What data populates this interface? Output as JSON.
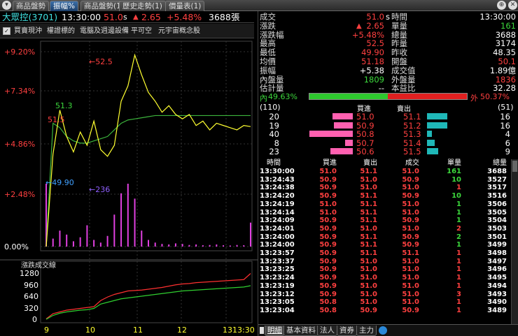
{
  "tabs": [
    {
      "label": "商品盤勢",
      "active": false
    },
    {
      "label": "振幅%",
      "active": true
    },
    {
      "label": "商品盤勢(1)",
      "active": false
    },
    {
      "label": "歷史走勢(1)",
      "active": false
    },
    {
      "label": "價量表(1)",
      "active": false
    }
  ],
  "header": {
    "symbol": "大眾控(3701)",
    "time": "13:30:00",
    "price": "51.0",
    "price_flag": "s",
    "change_arrow": "▲",
    "change": "2.65",
    "pct": "+5.48%",
    "volume": "3688",
    "volume_unit": "張"
  },
  "toolbar": {
    "items": [
      "買賣現沖",
      "權證標的",
      "電腦及週邊設備",
      "平可空",
      "元宇宙概念股"
    ]
  },
  "chart": {
    "y_labels": [
      "+9.20%",
      "+7.34%",
      "+4.86%",
      "+2.48%",
      "0.00%"
    ],
    "price_annotations": {
      "high": "←52.5",
      "open": "51.3",
      "low_mark": "51.5",
      "low": "←49.90",
      "max_vol": "←236"
    },
    "sub_title": "漲跌成交線",
    "sub_y_labels": [
      "1280",
      "960",
      "640",
      "320",
      "0"
    ],
    "x_labels": [
      "9",
      "10",
      "11",
      "12",
      "13",
      "13:30"
    ]
  },
  "chart_data": {
    "type": "line",
    "title": "",
    "xlabel": "",
    "ylabel": "",
    "x_ticks": [
      "9",
      "10",
      "11",
      "12",
      "13",
      "13:30"
    ],
    "ylim_pct": [
      0,
      9.2
    ],
    "series": [
      {
        "name": "",
        "color": "#ffff30",
        "description": "price line",
        "values_pct": [
          0,
          4.2,
          6.2,
          5.0,
          4.3,
          5.2,
          4.6,
          5.7,
          4.4,
          4.1,
          4.6,
          6.6,
          7.3,
          8.7,
          7.8,
          7.0,
          6.6,
          6.1,
          6.4,
          6.0,
          5.8,
          6.0,
          5.5,
          5.7,
          5.3,
          5.6,
          5.5,
          5.4,
          5.3,
          5.5,
          5.45
        ]
      },
      {
        "name": "",
        "color": "#3cb43c",
        "description": "average price line",
        "values_pct": [
          0,
          5.6,
          5.4,
          5.0,
          4.8,
          4.7,
          4.7,
          4.8,
          4.9,
          5.0,
          5.3,
          5.6,
          5.75,
          5.8,
          5.85,
          5.9,
          5.95,
          5.95,
          5.95,
          5.95,
          5.95,
          5.95,
          5.95,
          5.95,
          5.95,
          5.95,
          5.95,
          5.95,
          5.95,
          5.95,
          5.95
        ]
      }
    ],
    "volume_bars": [
      236,
      30,
      60,
      45,
      20,
      35,
      80,
      25,
      15,
      40,
      120,
      200,
      236,
      180,
      60,
      25,
      15,
      10,
      8,
      12,
      10,
      6,
      8,
      5,
      6,
      8,
      5,
      4,
      6,
      5,
      90
    ],
    "sub_series": [
      {
        "name": "",
        "color": "#ff3030",
        "values": [
          40,
          160,
          200,
          240,
          260,
          280,
          300,
          320,
          460,
          540,
          600,
          640,
          680,
          690,
          700,
          720,
          740,
          760,
          790,
          820,
          840,
          850,
          870,
          880,
          890,
          900,
          910,
          920,
          930,
          940,
          1080
        ]
      },
      {
        "name": "",
        "color": "#30d030",
        "values": [
          30,
          120,
          170,
          200,
          220,
          240,
          250,
          280,
          380,
          420,
          460,
          500,
          520,
          540,
          560,
          580,
          600,
          620,
          640,
          660,
          680,
          690,
          700,
          710,
          720,
          730,
          740,
          750,
          760,
          770,
          800
        ]
      }
    ],
    "sub_ylim": [
      0,
      1280
    ]
  },
  "quote": {
    "left": [
      {
        "label": "成交",
        "value": "51.0",
        "flag": "s",
        "color": "red"
      },
      {
        "label": "漲跌",
        "value": "2.65",
        "arrow": "▲",
        "color": "red"
      },
      {
        "label": "漲跌幅",
        "value": "+5.48%",
        "color": "red"
      },
      {
        "label": "最高",
        "value": "52.5",
        "color": "red"
      },
      {
        "label": "最低",
        "value": "49.90",
        "color": "red"
      },
      {
        "label": "均價",
        "value": "51.18",
        "color": "red"
      },
      {
        "label": "振幅",
        "value": "+5.38",
        "color": "white"
      },
      {
        "label": "內盤量",
        "value": "1809",
        "color": "green"
      },
      {
        "label": "估計量",
        "value": "--",
        "color": "white"
      }
    ],
    "right": [
      {
        "label": "時間",
        "value": "13:30:00",
        "color": "white"
      },
      {
        "label": "單量",
        "value": "161",
        "color": "green"
      },
      {
        "label": "總量",
        "value": "3688",
        "color": "white"
      },
      {
        "label": "昨量",
        "value": "3174",
        "color": "white"
      },
      {
        "label": "昨收",
        "value": "48.35",
        "color": "white"
      },
      {
        "label": "開盤",
        "value": "50.1",
        "color": "red"
      },
      {
        "label": "成交值",
        "value": "1.89億",
        "color": "white"
      },
      {
        "label": "外盤量",
        "value": "1836",
        "color": "red"
      },
      {
        "label": "本益比",
        "value": "32.28",
        "color": "white"
      }
    ]
  },
  "ratio": {
    "inner_label": "內",
    "inner_pct": "49.63%",
    "outer_label": "外",
    "outer_pct": "50.37%",
    "inner_value": 49.63
  },
  "book": {
    "bid_total": "(110)",
    "bid_header": "買進",
    "ask_header": "賣出",
    "ask_total": "(51)",
    "rows": [
      {
        "bid_qty": "20",
        "bid": "51.0",
        "ask": "51.1",
        "ask_qty": "16",
        "bid_bar": 0.46,
        "ask_bar": 0.8
      },
      {
        "bid_qty": "19",
        "bid": "50.9",
        "ask": "51.2",
        "ask_qty": "16",
        "bid_bar": 0.44,
        "ask_bar": 0.8
      },
      {
        "bid_qty": "40",
        "bid": "50.8",
        "ask": "51.3",
        "ask_qty": "4",
        "bid_bar": 1.0,
        "ask_bar": 0.2
      },
      {
        "bid_qty": "8",
        "bid": "50.7",
        "ask": "51.4",
        "ask_qty": "6",
        "bid_bar": 0.18,
        "ask_bar": 0.3
      },
      {
        "bid_qty": "23",
        "bid": "50.6",
        "ask": "51.5",
        "ask_qty": "9",
        "bid_bar": 0.52,
        "ask_bar": 0.45
      }
    ]
  },
  "ticks": {
    "headers": [
      "時間",
      "買進",
      "賣出",
      "成交",
      "單量",
      "總量"
    ],
    "rows": [
      {
        "time": "13:30:00",
        "bid": "51.0",
        "ask": "51.1",
        "price": "51.0",
        "qty": "161",
        "total": "3688",
        "qty_color": "green"
      },
      {
        "time": "13:24:43",
        "bid": "50.9",
        "ask": "51.0",
        "price": "50.9",
        "qty": "10",
        "total": "3527",
        "qty_color": "green"
      },
      {
        "time": "13:24:38",
        "bid": "50.9",
        "ask": "51.0",
        "price": "51.0",
        "qty": "1",
        "total": "3517",
        "qty_color": "red"
      },
      {
        "time": "13:24:20",
        "bid": "50.9",
        "ask": "51.1",
        "price": "50.9",
        "qty": "10",
        "total": "3516",
        "qty_color": "green"
      },
      {
        "time": "13:24:19",
        "bid": "51.0",
        "ask": "51.1",
        "price": "51.0",
        "qty": "1",
        "total": "3506",
        "qty_color": "green"
      },
      {
        "time": "13:24:14",
        "bid": "51.0",
        "ask": "51.1",
        "price": "51.0",
        "qty": "1",
        "total": "3505",
        "qty_color": "green"
      },
      {
        "time": "13:24:09",
        "bid": "50.9",
        "ask": "51.1",
        "price": "50.9",
        "qty": "1",
        "total": "3504",
        "qty_color": "green"
      },
      {
        "time": "13:24:01",
        "bid": "50.9",
        "ask": "51.0",
        "price": "51.0",
        "qty": "2",
        "total": "3503",
        "qty_color": "red"
      },
      {
        "time": "13:24:00",
        "bid": "50.9",
        "ask": "51.1",
        "price": "50.9",
        "qty": "2",
        "total": "3501",
        "qty_color": "green"
      },
      {
        "time": "13:24:00",
        "bid": "50.9",
        "ask": "51.1",
        "price": "50.9",
        "qty": "1",
        "total": "3499",
        "qty_color": "green"
      },
      {
        "time": "13:23:57",
        "bid": "50.9",
        "ask": "51.1",
        "price": "51.1",
        "qty": "1",
        "total": "3498",
        "qty_color": "red"
      },
      {
        "time": "13:23:37",
        "bid": "50.9",
        "ask": "51.0",
        "price": "51.0",
        "qty": "1",
        "total": "3497",
        "qty_color": "red"
      },
      {
        "time": "13:23:25",
        "bid": "50.9",
        "ask": "51.0",
        "price": "51.0",
        "qty": "1",
        "total": "3496",
        "qty_color": "red"
      },
      {
        "time": "13:23:24",
        "bid": "50.9",
        "ask": "51.0",
        "price": "51.0",
        "qty": "1",
        "total": "3495",
        "qty_color": "red"
      },
      {
        "time": "13:23:19",
        "bid": "50.9",
        "ask": "51.0",
        "price": "51.0",
        "qty": "1",
        "total": "3494",
        "qty_color": "red"
      },
      {
        "time": "13:23:12",
        "bid": "50.9",
        "ask": "51.0",
        "price": "51.0",
        "qty": "3",
        "total": "3493",
        "qty_color": "red"
      },
      {
        "time": "13:23:05",
        "bid": "50.8",
        "ask": "51.0",
        "price": "51.0",
        "qty": "1",
        "total": "3490",
        "qty_color": "red"
      },
      {
        "time": "13:23:04",
        "bid": "50.8",
        "ask": "50.9",
        "price": "50.9",
        "qty": "1",
        "total": "3489",
        "qty_color": "red"
      }
    ]
  },
  "bottom_tabs": [
    "明細",
    "基本資料",
    "法人",
    "資券",
    "主力"
  ]
}
